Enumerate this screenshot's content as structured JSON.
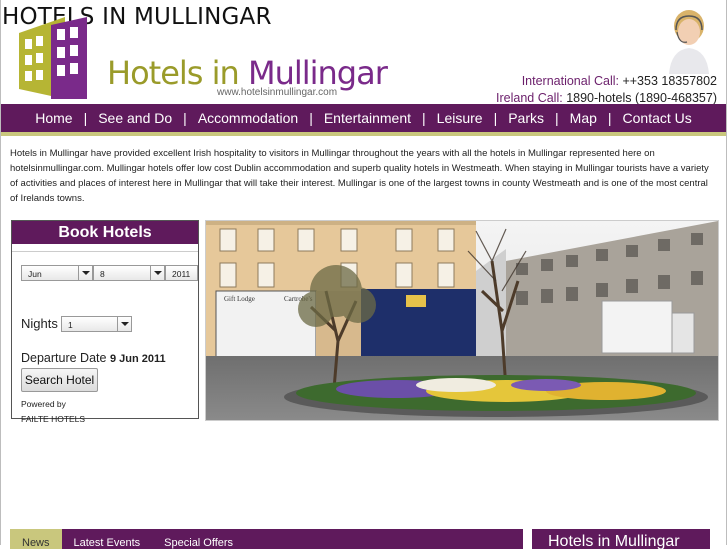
{
  "page": {
    "heading": "HOTELS IN MULLINGAR"
  },
  "logo": {
    "word1": "Hotels in ",
    "word2": "Mullingar",
    "url": "www.hotelsinmullingar.com"
  },
  "contact": {
    "intl_label": "International Call:",
    "intl_number": "++353 18357802",
    "ireland_label": "Ireland Call:",
    "ireland_number": "1890-hotels (1890-468357)"
  },
  "nav": {
    "items": [
      "Home",
      "See and Do",
      "Accommodation",
      "Entertainment",
      "Leisure",
      "Parks",
      "Map",
      "Contact Us"
    ]
  },
  "intro": "Hotels in Mullingar have provided excellent Irish hospitality to visitors in Mullingar throughout the years with all the hotels in Mullingar represented here on hotelsinmullingar.com. Mullingar hotels offer low cost Dublin accommodation and superb quality hotels in Westmeath. When staying in Mullingar tourists have a variety of activities and places of interest here in Mullingar that will take their interest. Mullingar is one of the largest towns in county Westmeath and is one of the most central of Irelands towns.",
  "booking": {
    "title": "Book Hotels",
    "month": "Jun",
    "day": "8",
    "year": "2011",
    "nights_label": "Nights",
    "nights": "1",
    "departure_label": "Departure Date",
    "departure_date": "9 Jun 2011",
    "search_label": "Search Hotel",
    "powered_label": "Powered by",
    "powered_by": "FAILTE HOTELS"
  },
  "photo": {
    "shop_sign1": "Gift Lodge",
    "shop_sign2": "Cartrobe's"
  },
  "tabs": {
    "items": [
      "News",
      "Latest Events",
      "Special Offers"
    ],
    "active": "News"
  },
  "side_box": {
    "title": "Hotels in Mullingar"
  },
  "colors": {
    "brand_purple": "#5f1a5c",
    "accent_olive": "#c9c77d",
    "logo_green": "#9a9b2a",
    "logo_purple": "#7a2a8a"
  }
}
